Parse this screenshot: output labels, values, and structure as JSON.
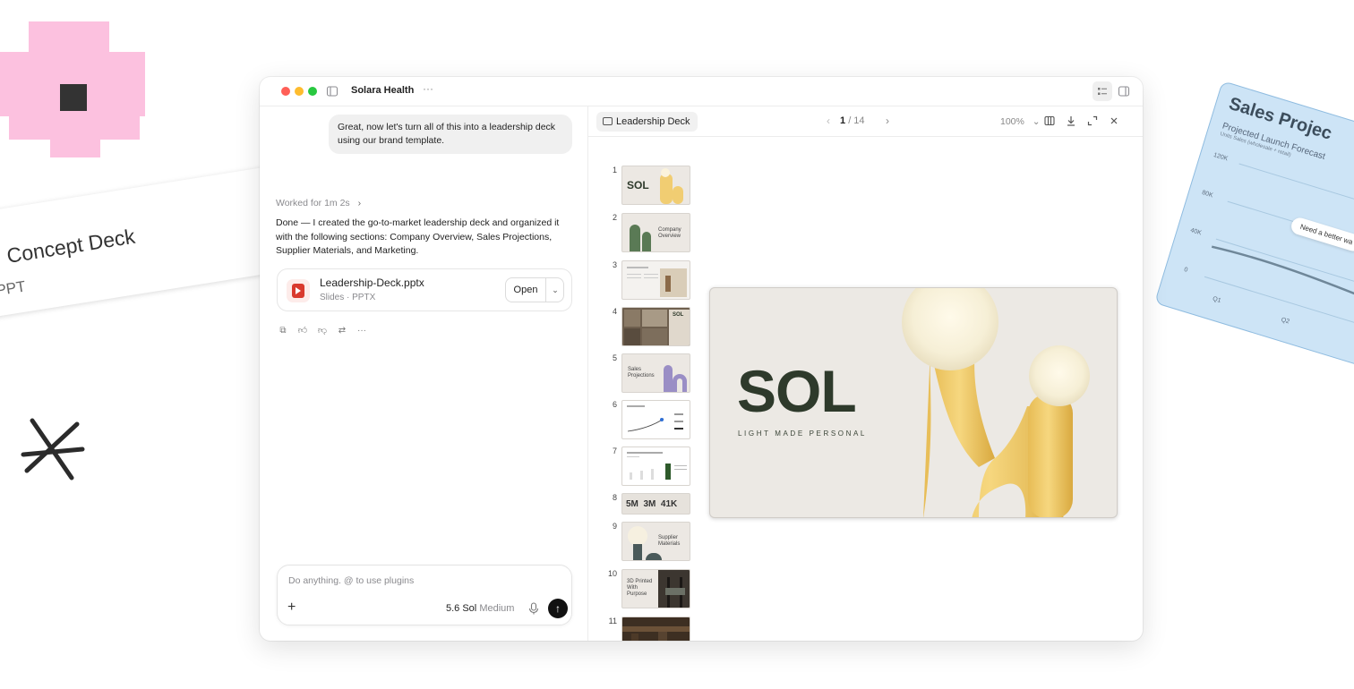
{
  "background": {
    "concept_card": {
      "title": "Concept Deck",
      "subtitle": "PPT"
    },
    "sales_card": {
      "title": "Sales Projec",
      "subtitle": "Projected Launch Forecast",
      "caption": "Units Sales (wholesale + retail)",
      "y_ticks": [
        "120K",
        "80K",
        "40K",
        "0"
      ],
      "x_ticks": [
        "Q1",
        "Q2"
      ],
      "note": "Need a better wa"
    }
  },
  "window": {
    "title": "Solara Health",
    "more": "···"
  },
  "chat": {
    "user_message": "Great, now let's turn all of this into a leadership deck using our brand template.",
    "worked_label": "Worked for 1m 2s",
    "assistant_reply": "Done — I created the go-to-market leadership deck and organized it with the following sections: Company Overview, Sales Projections, Supplier Materials, and Marketing.",
    "file": {
      "name": "Leadership-Deck.pptx",
      "meta": "Slides · PPTX",
      "open_label": "Open"
    },
    "composer": {
      "placeholder": "Do anything. @ to use plugins",
      "model_name": "5.6 Sol",
      "model_effort": "Medium"
    }
  },
  "deck": {
    "tab_label": "Leadership Deck",
    "page_current": "1",
    "page_total": "/ 14",
    "zoom": "100%",
    "thumbnails": [
      {
        "num": "1",
        "label": "SOL"
      },
      {
        "num": "2",
        "label": "Company Overview"
      },
      {
        "num": "3",
        "label": ""
      },
      {
        "num": "4",
        "label": "SOL"
      },
      {
        "num": "5",
        "label": "Sales Projections"
      },
      {
        "num": "6",
        "label": ""
      },
      {
        "num": "7",
        "label": ""
      },
      {
        "num": "8",
        "label": "5M  3M  41K"
      },
      {
        "num": "9",
        "label": "Supplier Materials"
      },
      {
        "num": "10",
        "label": "3D Printed With Purpose"
      },
      {
        "num": "11",
        "label": ""
      }
    ],
    "main_slide": {
      "logo": "SOL",
      "tagline": "LIGHT MADE PERSONAL"
    }
  },
  "colors": {
    "pink": "#fcc1df",
    "close": "#ff5f57",
    "minimize": "#febc2e",
    "zoom": "#28c840",
    "lamp_yellow": "#f1cd72",
    "sol_green": "#2e3a2b",
    "pptx_red": "#d93a2e"
  }
}
